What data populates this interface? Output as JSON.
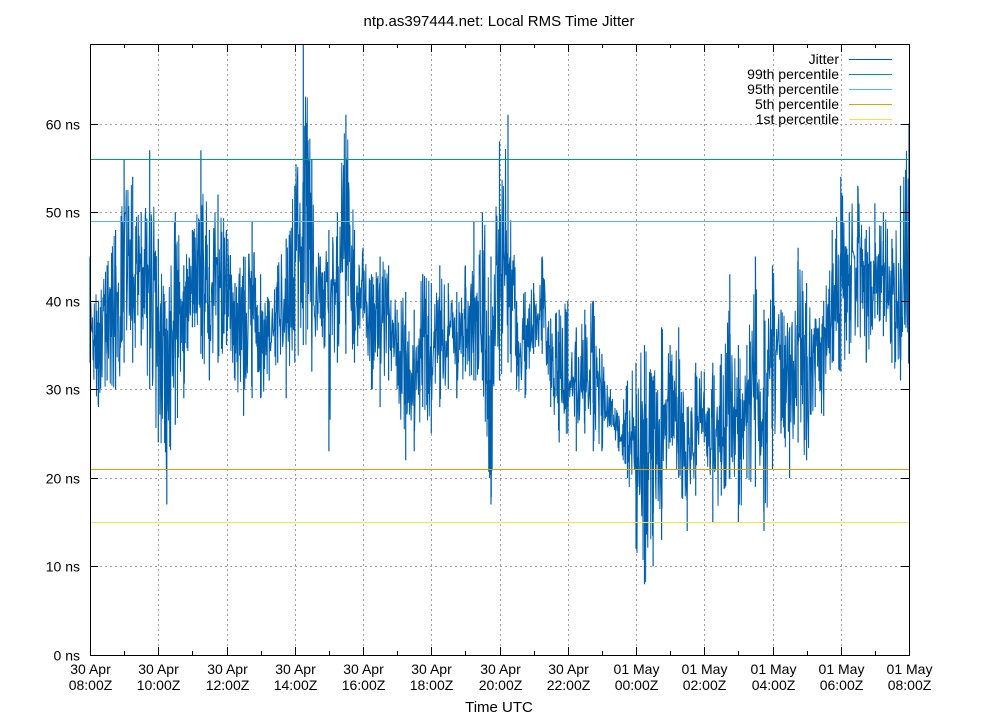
{
  "chart_data": {
    "type": "line",
    "title": "ntp.as397444.net: Local RMS Time Jitter",
    "xlabel": "Time UTC",
    "ylabel": "",
    "ylim": [
      0,
      69
    ],
    "x_range_hours": [
      0,
      24
    ],
    "grid": true,
    "legend_position": "top-right",
    "y_ticks": [
      {
        "value": 0,
        "label": "0 ns"
      },
      {
        "value": 10,
        "label": "10 ns"
      },
      {
        "value": 20,
        "label": "20 ns"
      },
      {
        "value": 30,
        "label": "30 ns"
      },
      {
        "value": 40,
        "label": "40 ns"
      },
      {
        "value": 50,
        "label": "50 ns"
      },
      {
        "value": 60,
        "label": "60 ns"
      }
    ],
    "x_ticks": [
      {
        "hour": 0,
        "line1": "30 Apr",
        "line2": "08:00Z"
      },
      {
        "hour": 2,
        "line1": "30 Apr",
        "line2": "10:00Z"
      },
      {
        "hour": 4,
        "line1": "30 Apr",
        "line2": "12:00Z"
      },
      {
        "hour": 6,
        "line1": "30 Apr",
        "line2": "14:00Z"
      },
      {
        "hour": 8,
        "line1": "30 Apr",
        "line2": "16:00Z"
      },
      {
        "hour": 10,
        "line1": "30 Apr",
        "line2": "18:00Z"
      },
      {
        "hour": 12,
        "line1": "30 Apr",
        "line2": "20:00Z"
      },
      {
        "hour": 14,
        "line1": "30 Apr",
        "line2": "22:00Z"
      },
      {
        "hour": 16,
        "line1": "01 May",
        "line2": "00:00Z"
      },
      {
        "hour": 18,
        "line1": "01 May",
        "line2": "02:00Z"
      },
      {
        "hour": 20,
        "line1": "01 May",
        "line2": "04:00Z"
      },
      {
        "hour": 22,
        "line1": "01 May",
        "line2": "06:00Z"
      },
      {
        "hour": 24,
        "line1": "01 May",
        "line2": "08:00Z"
      }
    ],
    "series": [
      {
        "name": "Jitter",
        "color": "#0060ad",
        "kind": "series",
        "x_hours": [
          0,
          0.25,
          0.5,
          0.75,
          1,
          1.25,
          1.5,
          1.75,
          2,
          2.25,
          2.5,
          2.75,
          3,
          3.25,
          3.5,
          3.75,
          4,
          4.25,
          4.5,
          4.75,
          5,
          5.25,
          5.5,
          5.75,
          6,
          6.25,
          6.5,
          6.75,
          7,
          7.25,
          7.5,
          7.75,
          8,
          8.25,
          8.5,
          8.75,
          9,
          9.25,
          9.5,
          9.75,
          10,
          10.25,
          10.5,
          10.75,
          11,
          11.25,
          11.5,
          11.75,
          12,
          12.25,
          12.5,
          12.75,
          13,
          13.25,
          13.5,
          13.75,
          14,
          14.25,
          14.5,
          14.75,
          15,
          15.25,
          15.5,
          15.75,
          16,
          16.25,
          16.5,
          16.75,
          17,
          17.25,
          17.5,
          17.75,
          18,
          18.25,
          18.5,
          18.75,
          19,
          19.25,
          19.5,
          19.75,
          20,
          20.25,
          20.5,
          20.75,
          21,
          21.25,
          21.5,
          21.75,
          22,
          22.25,
          22.5,
          22.75,
          23,
          23.25,
          23.5,
          23.75,
          24
        ],
        "lows": [
          33,
          28,
          31,
          30,
          33,
          33,
          35,
          30,
          24,
          17,
          26,
          29,
          37,
          34,
          31,
          33,
          35,
          31,
          27,
          29,
          29,
          31,
          33,
          29,
          33,
          35,
          32,
          38,
          23,
          33,
          34,
          33,
          38,
          30,
          28,
          31,
          30,
          22,
          23,
          28,
          25,
          28,
          30,
          29,
          32,
          31,
          31,
          17,
          31,
          33,
          30,
          29,
          34,
          34,
          28,
          24,
          25,
          23,
          25,
          23,
          23,
          26,
          23,
          20,
          12,
          8,
          10,
          13,
          24,
          20,
          14,
          18,
          24,
          15,
          18,
          20,
          15,
          20,
          19,
          14,
          21,
          25,
          20,
          24,
          22,
          28,
          27,
          33,
          32,
          34,
          37,
          33,
          38,
          36,
          33,
          31,
          33,
          37,
          39
        ],
        "highs": [
          45,
          40,
          44,
          48,
          56,
          54,
          50,
          57,
          47,
          38,
          50,
          44,
          48,
          57,
          48,
          52,
          48,
          42,
          45,
          49,
          43,
          40,
          44,
          47,
          53,
          69,
          56,
          45,
          48,
          50,
          61,
          48,
          46,
          43,
          45,
          44,
          39,
          41,
          39,
          43,
          42,
          44,
          42,
          41,
          44,
          49,
          50,
          45,
          58,
          61,
          40,
          41,
          42,
          45,
          38,
          39,
          40,
          37,
          39,
          40,
          34,
          30,
          27,
          31,
          33,
          35,
          31,
          37,
          35,
          37,
          28,
          33,
          32,
          33,
          34,
          43,
          35,
          35,
          45,
          39,
          44,
          39,
          37,
          46,
          42,
          38,
          40,
          48,
          54,
          50,
          53,
          48,
          51,
          50,
          47,
          53,
          60,
          55,
          53
        ]
      },
      {
        "name": "99th percentile",
        "color": "#009e73",
        "kind": "level",
        "value": 56
      },
      {
        "name": "95th percentile",
        "color": "#56b4e9",
        "kind": "level",
        "value": 49
      },
      {
        "name": "5th percentile",
        "color": "#e69f00",
        "kind": "level",
        "value": 21
      },
      {
        "name": "1st percentile",
        "color": "#f0e442",
        "kind": "level",
        "value": 15
      }
    ]
  }
}
